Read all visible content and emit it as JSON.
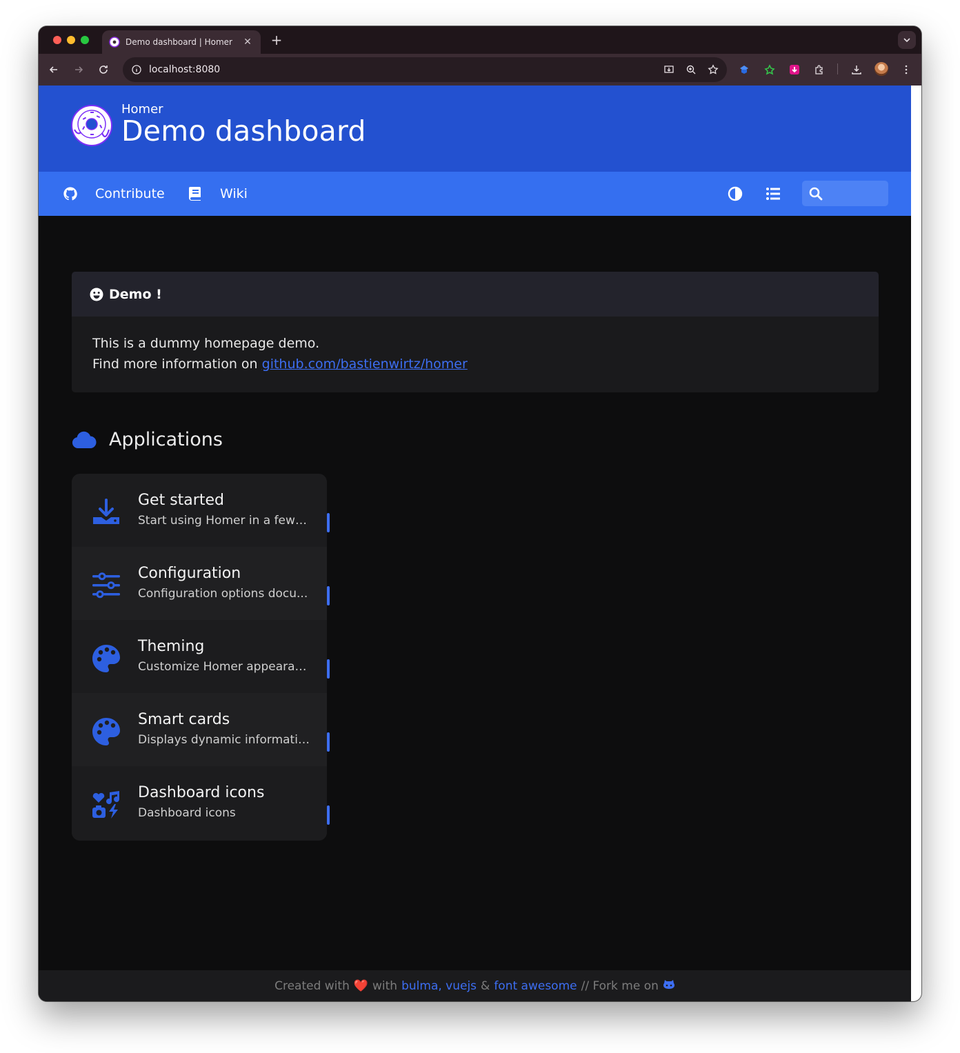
{
  "browser": {
    "tab_title": "Demo dashboard | Homer",
    "new_tab_label": "+",
    "tab_close_label": "✕",
    "url": "localhost:8080"
  },
  "header": {
    "subtitle": "Homer",
    "title": "Demo dashboard"
  },
  "navbar": {
    "links": [
      {
        "label": "Contribute",
        "icon": "github-icon"
      },
      {
        "label": "Wiki",
        "icon": "book-icon"
      }
    ],
    "search_placeholder": ""
  },
  "message": {
    "title": "Demo !",
    "icon": "smile-icon",
    "line1": "This is a dummy homepage demo.",
    "line2_prefix": "Find more information on ",
    "link_text": "github.com/bastienwirtz/homer"
  },
  "group": {
    "name": "Applications",
    "icon": "cloud-icon"
  },
  "cards": [
    {
      "title": "Get started",
      "subtitle": "Start using Homer in a few …",
      "icon": "download-icon"
    },
    {
      "title": "Configuration",
      "subtitle": "Configuration options docu...",
      "icon": "sliders-icon"
    },
    {
      "title": "Theming",
      "subtitle": "Customize Homer appearan...",
      "icon": "palette-icon"
    },
    {
      "title": "Smart cards",
      "subtitle": "Displays dynamic informatio...",
      "icon": "palette-icon"
    },
    {
      "title": "Dashboard icons",
      "subtitle": "Dashboard icons",
      "icon": "icons-icon"
    }
  ],
  "footer": {
    "created_with": "Created with",
    "heart": "❤️",
    "with": "with",
    "link1": "bulma, vuejs",
    "amp": "&",
    "link2": "font awesome",
    "fork": "// Fork me on"
  },
  "colors": {
    "hero": "#2351d0",
    "navbar": "#356ff0",
    "accent": "#3d6ef2",
    "background": "#0d0d0e",
    "card": "#1c1c1e"
  }
}
